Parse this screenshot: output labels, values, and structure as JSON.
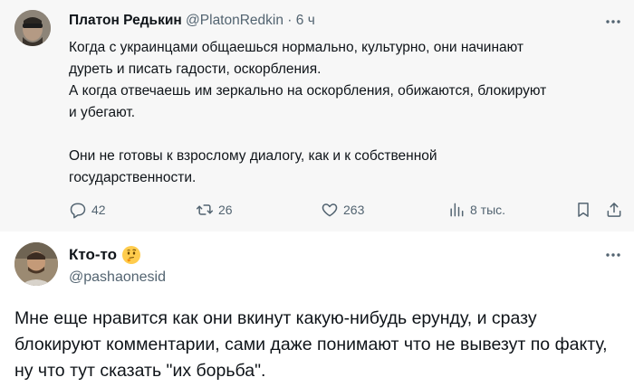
{
  "original_tweet": {
    "author_name": "Платон Редькин",
    "author_handle": "@PlatonRedkin",
    "separator": "·",
    "time": "6 ч",
    "text_lines": [
      "Когда с украинцами общаешься нормально, культурно, они начинают",
      "дуреть и писать гадости, оскорбления.",
      "А когда отвечаешь им зеркально на оскорбления, обижаются, блокируют",
      "и убегают.",
      "",
      "Они не готовы к взрослому диалогу, как и к собственной",
      "государственности."
    ],
    "stats": {
      "replies": "42",
      "retweets": "26",
      "likes": "263",
      "views": "8 тыс."
    }
  },
  "reply_tweet": {
    "author_name": "Кто-то",
    "author_emoji": "thinking-face-emoji",
    "author_handle": "@pashaonesid",
    "text": "Мне еще нравится как они вкинут какую-нибудь ерунду, и сразу блокируют комментарии, сами даже понимают что не вывезут по факту, ну что тут сказать \"их борьба\"."
  },
  "icons": {
    "reply": "reply-icon",
    "retweet": "retweet-icon",
    "like": "heart-icon",
    "views": "views-chart-icon",
    "bookmark": "bookmark-icon",
    "share": "share-icon",
    "more": "more-dots-icon"
  },
  "colors": {
    "text_primary": "#0f1419",
    "text_secondary": "#536471",
    "quoted_background": "#f7f7f7"
  }
}
